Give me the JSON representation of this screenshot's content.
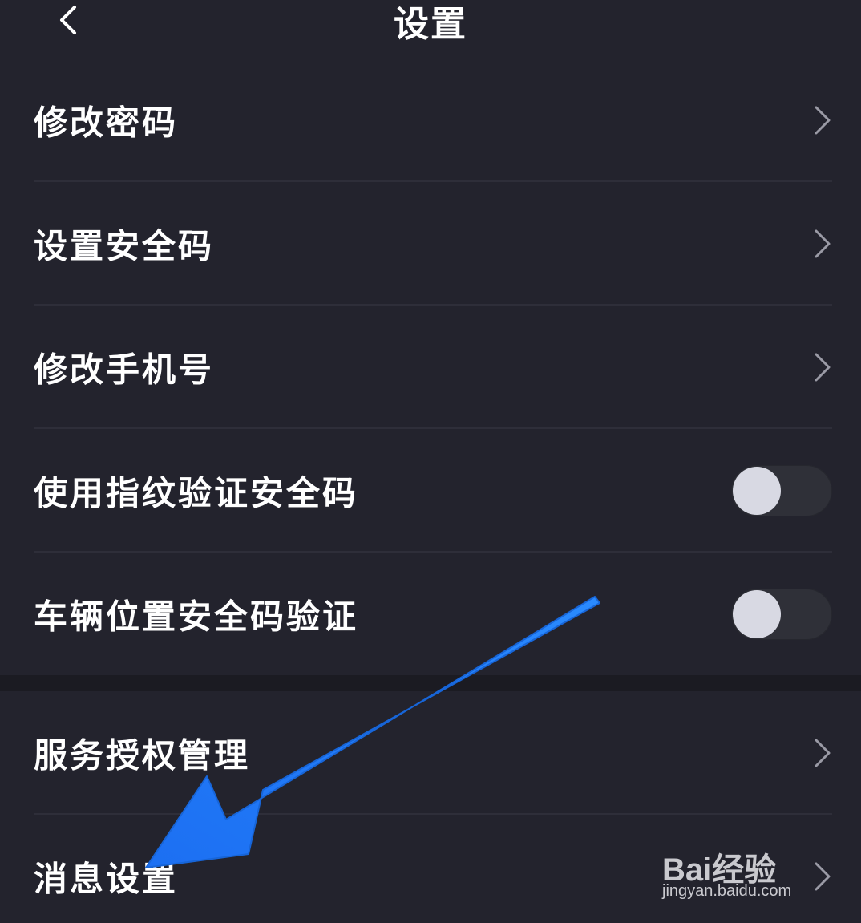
{
  "header": {
    "title": "设置"
  },
  "settings": {
    "items": [
      {
        "label": "修改密码",
        "control": "chevron"
      },
      {
        "label": "设置安全码",
        "control": "chevron"
      },
      {
        "label": "修改手机号",
        "control": "chevron"
      },
      {
        "label": "使用指纹验证安全码",
        "control": "toggle",
        "on": false
      },
      {
        "label": "车辆位置安全码验证",
        "control": "toggle",
        "on": false
      },
      {
        "label": "服务授权管理",
        "control": "chevron"
      },
      {
        "label": "消息设置",
        "control": "chevron"
      }
    ]
  },
  "watermark": {
    "brand": "Bai经验",
    "url": "jingyan.baidu.com"
  },
  "colors": {
    "background": "#23232d",
    "text": "#ffffff",
    "chevron": "#9a9aa5",
    "arrow": "#1f7bf5",
    "toggle_track": "#2f3038",
    "toggle_knob": "#d8d9e3"
  }
}
